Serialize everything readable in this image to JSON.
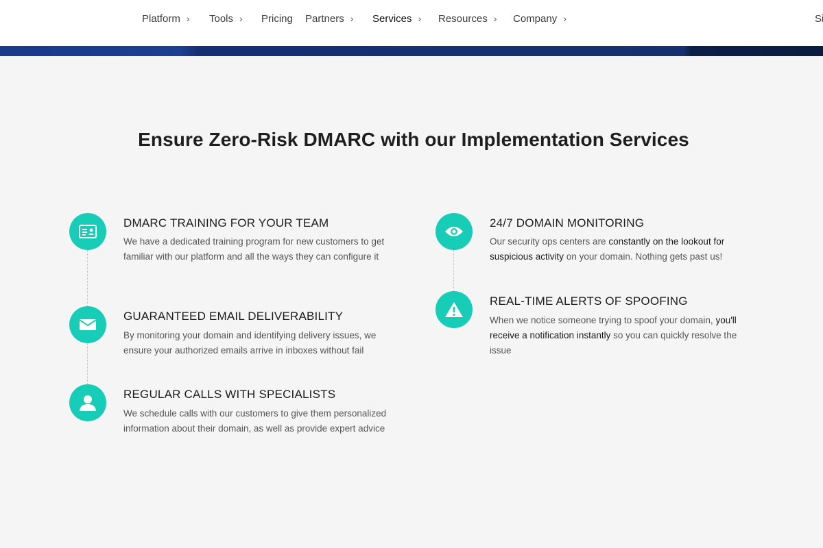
{
  "nav": {
    "items": [
      {
        "label": "Platform",
        "has_menu": true
      },
      {
        "label": "Tools",
        "has_menu": true
      },
      {
        "label": "Pricing",
        "has_menu": false
      },
      {
        "label": "Partners",
        "has_menu": true
      },
      {
        "label": "Services",
        "has_menu": true
      },
      {
        "label": "Resources",
        "has_menu": true
      },
      {
        "label": "Company",
        "has_menu": true
      }
    ],
    "signin_partial": "Si"
  },
  "main": {
    "heading": "Ensure Zero-Risk DMARC with our Implementation Services",
    "features_left": [
      {
        "title": "DMARC TRAINING FOR YOUR TEAM",
        "icon": "id-card-icon",
        "desc_1": "We have a dedicated training program for new customers to get familiar with our platform and all the ways they can configure it"
      },
      {
        "title": "GUARANTEED EMAIL DELIVERABILITY",
        "icon": "envelope-icon",
        "desc_1": "By monitoring your domain and identifying delivery issues, we ensure your authorized emails arrive in inboxes without fail"
      },
      {
        "title": "REGULAR CALLS WITH SPECIALISTS",
        "icon": "user-icon",
        "desc_1": "We schedule calls with our customers to give them personalized information about their domain, as well as provide expert advice"
      }
    ],
    "features_right": [
      {
        "title": "24/7 DOMAIN MONITORING",
        "icon": "eye-icon",
        "desc_1": "Our security ops centers are",
        "desc_hl": "constantly on the lookout for suspicious activity",
        "desc_2": "on your domain. Nothing gets past us!"
      },
      {
        "title": "REAL-TIME ALERTS OF SPOOFING",
        "icon": "warning-icon",
        "desc_1": "When we notice someone trying to spoof your domain,",
        "desc_hl": "you'll receive a notification instantly",
        "desc_2": "so you can quickly resolve the issue"
      }
    ]
  },
  "colors": {
    "accent": "#17cdb8",
    "band": "#16306f",
    "background": "#f5f5f5"
  }
}
